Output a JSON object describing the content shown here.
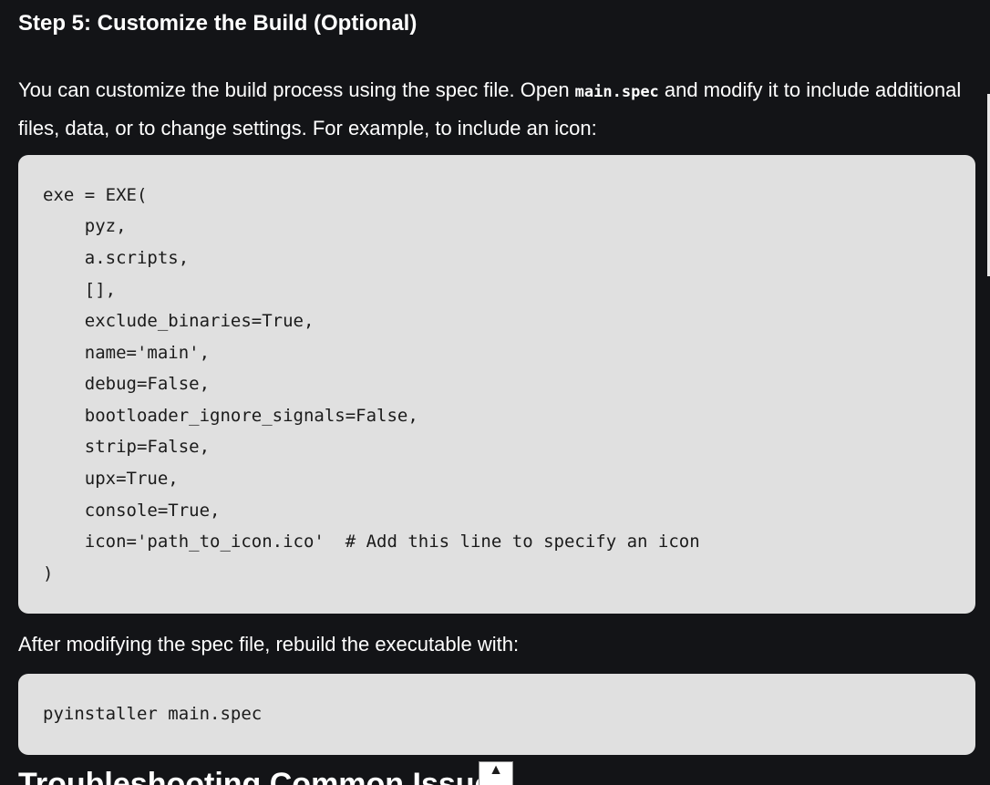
{
  "step": {
    "heading": "Step 5: Customize the Build (Optional)"
  },
  "intro": {
    "text_before": "You can customize the build process using the spec file. Open ",
    "inline_code": "main.spec",
    "text_after": " and modify it to include additional files, data, or to change settings. For example, to include an icon:"
  },
  "spec_code": {
    "lines": [
      "exe = EXE(",
      "    pyz,",
      "    a.scripts,",
      "    [],",
      "    exclude_binaries=True,",
      "    name='main',",
      "    debug=False,",
      "    bootloader_ignore_signals=False,",
      "    strip=False,",
      "    upx=True,",
      "    console=True,",
      "    icon='path_to_icon.ico'  # Add this line to specify an icon",
      ")"
    ]
  },
  "rebuild": {
    "text": "After modifying the spec file, rebuild the executable with:"
  },
  "rebuild_code": {
    "lines": [
      "pyinstaller main.spec"
    ]
  },
  "next_section": {
    "heading": "Troubleshooting Common Issues"
  },
  "scroll_top": {
    "icon": "▲"
  },
  "colors": {
    "page_background": "#131417",
    "code_background": "#e0e0e0",
    "text": "#ffffff",
    "code_text": "#1b1b1b"
  }
}
